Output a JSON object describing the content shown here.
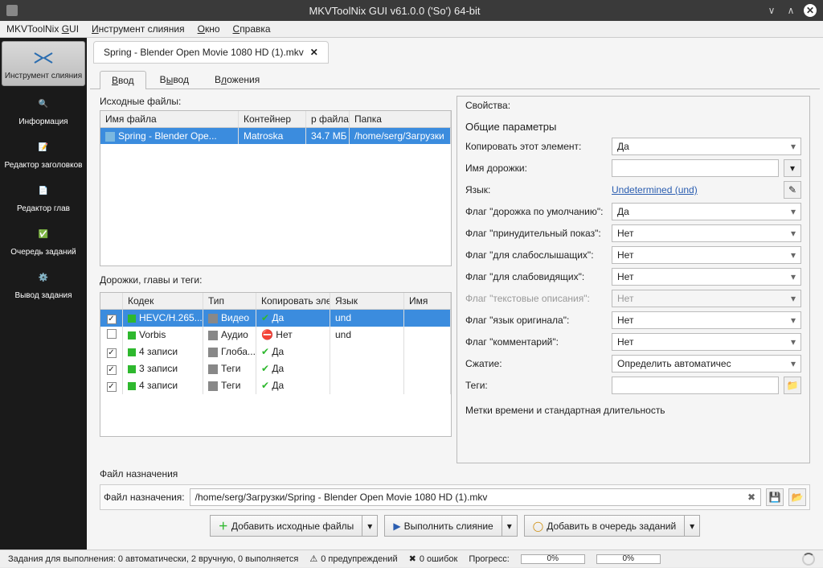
{
  "titlebar": {
    "title": "MKVToolNix GUI v61.0.0 ('So') 64-bit"
  },
  "menubar": {
    "app": "MKVToolNix GUI",
    "merge": "Инструмент слияния",
    "window": "Окно",
    "help": "Справка"
  },
  "sidebar": {
    "merge": "Инструмент слияния",
    "info": "Информация",
    "headers": "Редактор заголовков",
    "chapters": "Редактор глав",
    "jobs": "Очередь заданий",
    "output": "Вывод задания"
  },
  "doc_tab": "Spring - Blender Open Movie 1080 HD (1).mkv",
  "tabs": {
    "input": "Ввод",
    "output": "Вывод",
    "attachments": "Вложения"
  },
  "left": {
    "src_label": "Исходные файлы:",
    "src_headers": {
      "name": "Имя файла",
      "container": "Контейнер",
      "size": "р файла",
      "folder": "Папка"
    },
    "src_row": {
      "name": "Spring - Blender Ope...",
      "container": "Matroska",
      "size": "34.7 МБ",
      "folder": "/home/serg/Загрузки"
    },
    "tracks_label": "Дорожки, главы и теги:",
    "tracks_headers": {
      "codec": "Кодек",
      "type": "Тип",
      "copy": "Копировать элем",
      "lang": "Язык",
      "name": "Имя"
    },
    "tracks": [
      {
        "chk": true,
        "color": "g",
        "codec": "HEVC/H.265...",
        "type": "Видео",
        "copy": "Да",
        "copy_ok": true,
        "lang": "und"
      },
      {
        "chk": false,
        "color": "g",
        "codec": "Vorbis",
        "type": "Аудио",
        "copy": "Нет",
        "copy_ok": false,
        "lang": "und"
      },
      {
        "chk": true,
        "color": "g",
        "codec": "4 записи",
        "type": "Глоба...",
        "copy": "Да",
        "copy_ok": true,
        "lang": ""
      },
      {
        "chk": true,
        "color": "g",
        "codec": "3 записи",
        "type": "Теги",
        "copy": "Да",
        "copy_ok": true,
        "lang": ""
      },
      {
        "chk": true,
        "color": "g",
        "codec": "4 записи",
        "type": "Теги",
        "copy": "Да",
        "copy_ok": true,
        "lang": ""
      }
    ]
  },
  "props": {
    "label": "Свойства:",
    "general_hdr": "Общие параметры",
    "copy_label": "Копировать этот элемент:",
    "copy_val": "Да",
    "trackname_label": "Имя дорожки:",
    "trackname_val": "",
    "lang_label": "Язык:",
    "lang_val": "Undetermined (und)",
    "default_label": "Флаг \"дорожка по умолчанию\":",
    "default_val": "Да",
    "forced_label": "Флаг \"принудительный показ\":",
    "forced_val": "Нет",
    "hearing_label": "Флаг \"для слабослышащих\":",
    "hearing_val": "Нет",
    "visual_label": "Флаг \"для слабовидящих\":",
    "visual_val": "Нет",
    "textdesc_label": "Флаг \"текстовые описания\":",
    "textdesc_val": "Нет",
    "origlang_label": "Флаг \"язык оригинала\":",
    "origlang_val": "Нет",
    "comment_label": "Флаг \"комментарий\":",
    "comment_val": "Нет",
    "compress_label": "Сжатие:",
    "compress_val": "Определить автоматичес",
    "tags_label": "Теги:",
    "tags_val": "",
    "timestamps_hdr": "Метки времени и стандартная длительность"
  },
  "dest": {
    "toplabel": "Файл назначения",
    "label": "Файл назначения:",
    "path": "/home/serg/Загрузки/Spring - Blender Open Movie 1080 HD (1).mkv"
  },
  "actions": {
    "add": "Добавить исходные файлы",
    "mux": "Выполнить слияние",
    "queue": "Добавить в очередь заданий"
  },
  "status": {
    "jobs": "Задания для выполнения:  0 автоматически, 2 вручную, 0 выполняется",
    "warnings": "0 предупреждений",
    "errors": "0 ошибок",
    "progress": "Прогресс:",
    "pct": "0%"
  }
}
